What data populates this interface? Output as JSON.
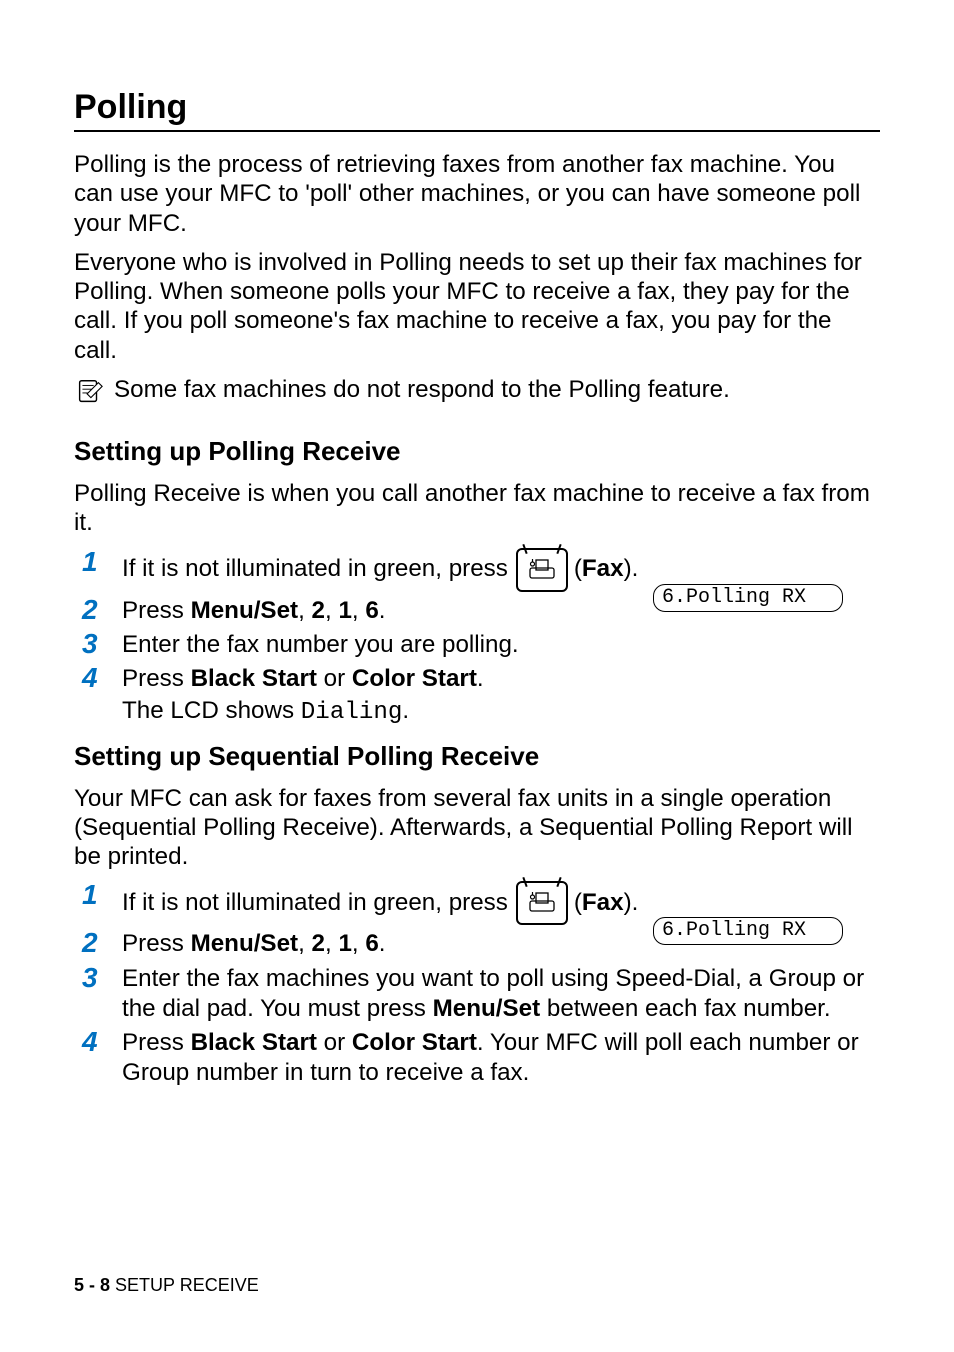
{
  "h1": "Polling",
  "intro1": "Polling is the process of retrieving faxes from another fax machine. You can use your MFC to 'poll' other machines, or you can have someone poll your MFC.",
  "intro2": "Everyone who is involved in Polling needs to set up their fax machines for Polling. When someone polls your MFC to receive a fax, they pay for the call. If you poll someone's fax machine to receive a fax, you pay for the call.",
  "note": "Some fax machines do not respond to the Polling feature.",
  "section_a": {
    "title": "Setting up Polling Receive",
    "intro": "Polling Receive is when you call another fax machine to receive a fax from it.",
    "lcd": "6.Polling RX",
    "steps": {
      "s1_pre": "If it is not illuminated in green, press ",
      "s1_fax_open": " (",
      "s1_fax": "Fax",
      "s1_fax_close": ").",
      "s2_pre": "Press ",
      "s2_bold": "Menu/Set",
      "s2_rest": ", ",
      "s2_k1": "2",
      "s2_k2": "1",
      "s2_k3": "6",
      "s2_sep": ", ",
      "s2_end": ".",
      "s3": "Enter the fax number you are polling.",
      "s4_pre": "Press ",
      "s4_b1": "Black Start",
      "s4_mid": " or ",
      "s4_b2": "Color Start",
      "s4_end": ".",
      "s4_sub_pre": "The LCD shows ",
      "s4_sub_code": "Dialing",
      "s4_sub_end": "."
    }
  },
  "section_b": {
    "title": "Setting up Sequential Polling Receive",
    "intro": "Your MFC can ask for faxes from several fax units in a single operation (Sequential Polling Receive). Afterwards, a Sequential Polling Report will be printed.",
    "lcd": "6.Polling RX",
    "steps": {
      "s1_pre": "If it is not illuminated in green, press ",
      "s1_fax_open": " (",
      "s1_fax": "Fax",
      "s1_fax_close": ").",
      "s2_pre": "Press ",
      "s2_bold": "Menu/Set",
      "s2_rest": ", ",
      "s2_k1": "2",
      "s2_k2": "1",
      "s2_k3": "6",
      "s2_sep": ", ",
      "s2_end": ".",
      "s3_pre": "Enter the fax machines you want to poll using Speed-Dial, a Group or the dial pad. You must press ",
      "s3_bold": "Menu/Set",
      "s3_post": " between each fax number.",
      "s4_pre": "Press ",
      "s4_b1": "Black Start",
      "s4_mid": " or ",
      "s4_b2": "Color Start",
      "s4_end": ". Your MFC will poll each number or Group number in turn to receive a fax."
    }
  },
  "footer": {
    "page": "5 - 8",
    "sep": "   ",
    "section": "SETUP RECEIVE"
  }
}
